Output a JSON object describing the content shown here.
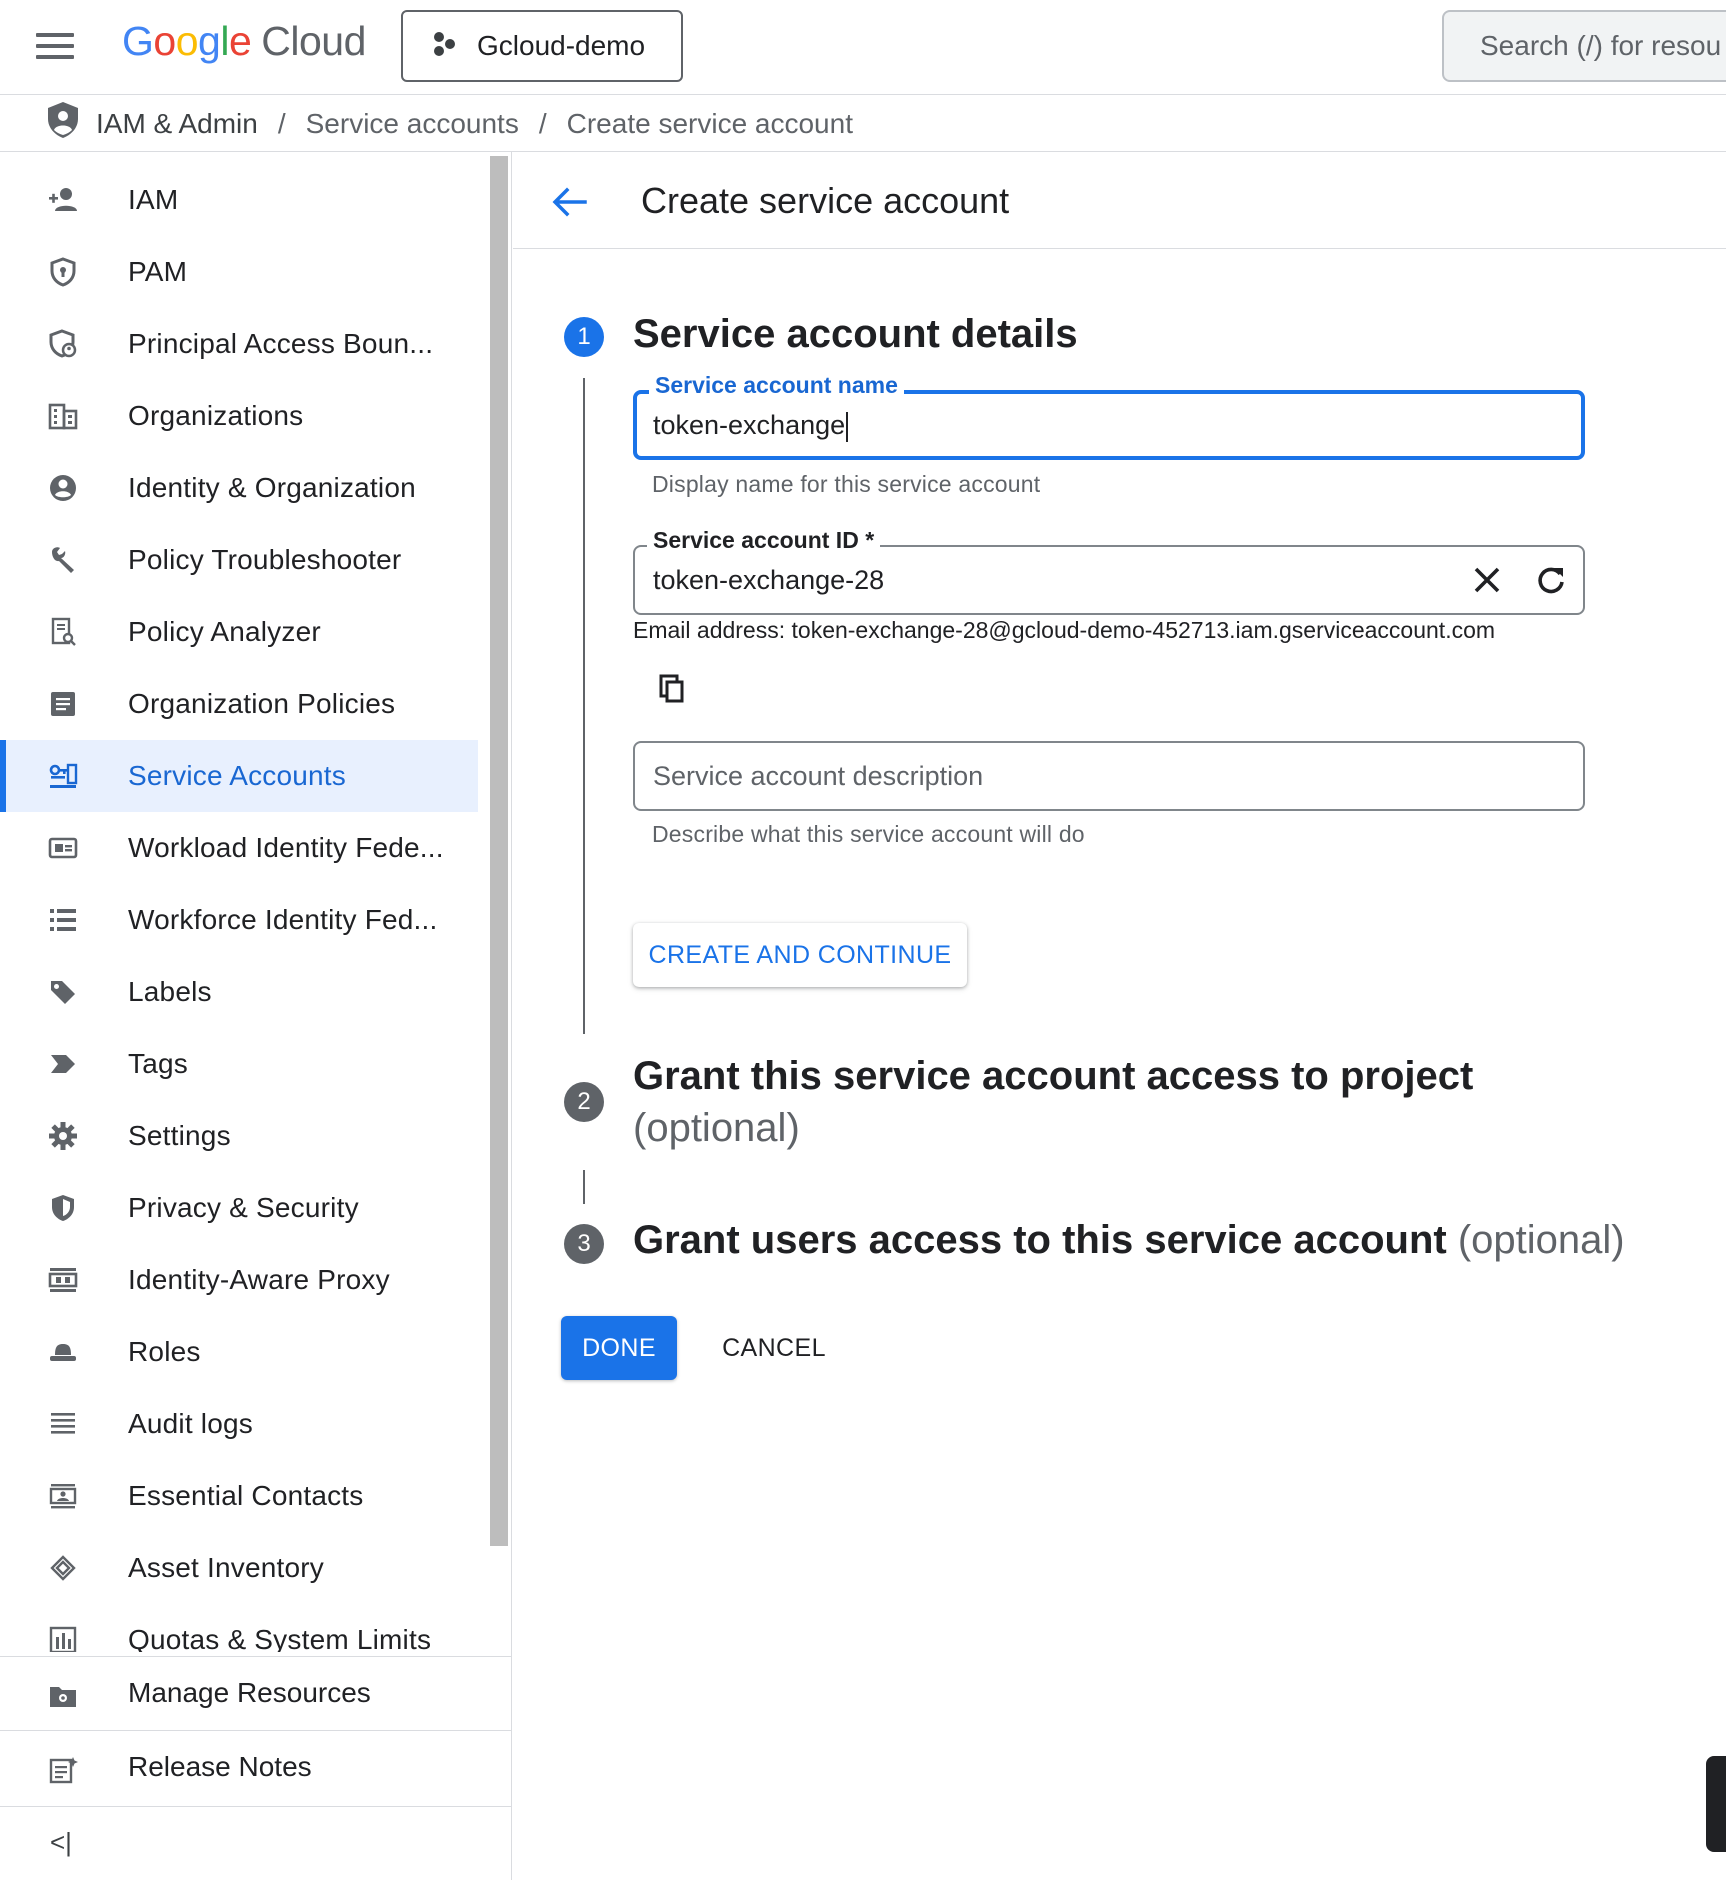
{
  "topbar": {
    "logo_letters": [
      "G",
      "o",
      "o",
      "g",
      "l",
      "e"
    ],
    "logo_product": "Cloud",
    "project_name": "Gcloud-demo",
    "search_placeholder": "Search (/) for resou"
  },
  "breadcrumb": {
    "items": [
      "IAM & Admin",
      "Service accounts",
      "Create service account"
    ],
    "separator": "/"
  },
  "sidebar": {
    "items": [
      {
        "label": "IAM",
        "icon": "person-add-icon"
      },
      {
        "label": "PAM",
        "icon": "shield-lock-icon"
      },
      {
        "label": "Principal Access Boun...",
        "icon": "shield-person-icon"
      },
      {
        "label": "Organizations",
        "icon": "building-icon"
      },
      {
        "label": "Identity & Organization",
        "icon": "account-circle-icon"
      },
      {
        "label": "Policy Troubleshooter",
        "icon": "wrench-icon"
      },
      {
        "label": "Policy Analyzer",
        "icon": "document-search-icon"
      },
      {
        "label": "Organization Policies",
        "icon": "list-box-icon"
      },
      {
        "label": "Service Accounts",
        "icon": "service-account-icon",
        "active": true
      },
      {
        "label": "Workload Identity Fede...",
        "icon": "id-card-icon"
      },
      {
        "label": "Workforce Identity Fed...",
        "icon": "list-icon"
      },
      {
        "label": "Labels",
        "icon": "label-icon"
      },
      {
        "label": "Tags",
        "icon": "tag-arrow-icon"
      },
      {
        "label": "Settings",
        "icon": "gear-icon"
      },
      {
        "label": "Privacy & Security",
        "icon": "shield-icon"
      },
      {
        "label": "Identity-Aware Proxy",
        "icon": "proxy-icon"
      },
      {
        "label": "Roles",
        "icon": "hat-icon"
      },
      {
        "label": "Audit logs",
        "icon": "lines-icon"
      },
      {
        "label": "Essential Contacts",
        "icon": "contact-card-icon"
      },
      {
        "label": "Asset Inventory",
        "icon": "diamond-stack-icon"
      },
      {
        "label": "Quotas & System Limits",
        "icon": "quota-icon"
      }
    ],
    "manage_resources": "Manage Resources",
    "release_notes": "Release Notes",
    "collapse_label": "<|"
  },
  "page": {
    "title": "Create service account"
  },
  "steps": [
    {
      "number": "1",
      "title": "Service account details",
      "optional": ""
    },
    {
      "number": "2",
      "title": "Grant this service account access to project",
      "optional": "(optional)"
    },
    {
      "number": "3",
      "title": "Grant users access to this service account",
      "optional": "(optional)"
    }
  ],
  "form": {
    "name_label": "Service account name",
    "name_value": "token-exchange",
    "name_helper": "Display name for this service account",
    "id_label": "Service account ID *",
    "id_value": "token-exchange-28",
    "email_text": "Email address: token-exchange-28@gcloud-demo-452713.iam.gserviceaccount.com",
    "description_placeholder": "Service account description",
    "description_helper": "Describe what this service account will do"
  },
  "buttons": {
    "create_continue": "CREATE AND CONTINUE",
    "done": "DONE",
    "cancel": "CANCEL"
  },
  "colors": {
    "accent": "#1a73e8",
    "active_nav_bg": "#e8f0fe",
    "step_inactive": "#5f6368"
  }
}
